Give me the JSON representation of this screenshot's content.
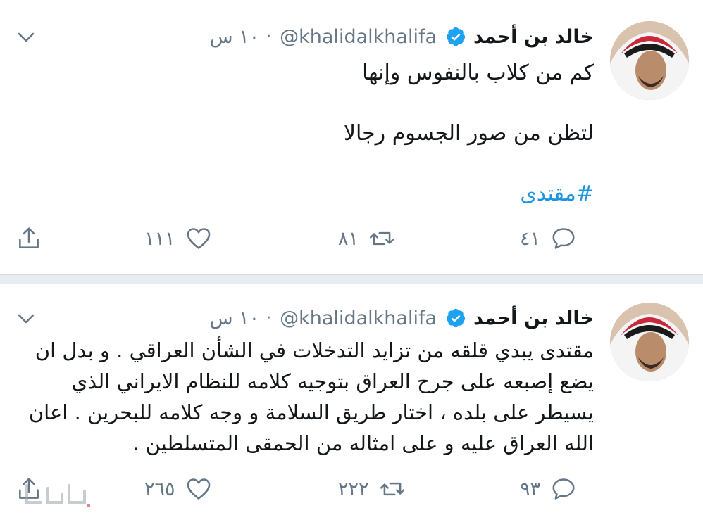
{
  "tweets": [
    {
      "author_name": "خالد بن أحمد",
      "handle": "@khalidalkhalifa",
      "separator": "·",
      "time": "١٠ س",
      "lines": [
        "كم من كلاب بالنفوس وإنها",
        "لتظن من صور الجسوم رجالا"
      ],
      "hashtag": "#مقتدى",
      "replies": "٤١",
      "retweets": "٨١",
      "likes": "١١١"
    },
    {
      "author_name": "خالد بن أحمد",
      "handle": "@khalidalkhalifa",
      "separator": "·",
      "time": "١٠ س",
      "body": "مقتدى يبدي قلقه من تزايد التدخلات في الشأن العراقي . و بدل ان يضع إصبعه على جرح العراق بتوجيه كلامه للنظام الايراني الذي يسيطر على بلده ، اختار  طريق السلامة و وجه كلامه للبحرين . اعان الله العراق عليه و على امثاله من الحمقى المتسلطين .",
      "replies": "٩٣",
      "retweets": "٢٢٢",
      "likes": "٢٦٥"
    }
  ],
  "icons": {
    "verified": "verified-badge-icon",
    "caret": "chevron-down-icon",
    "reply": "reply-icon",
    "retweet": "retweet-icon",
    "like": "heart-icon",
    "share": "share-icon"
  },
  "colors": {
    "text": "#14171a",
    "secondary": "#657786",
    "accent": "#1b95e0",
    "separator": "#e6ecf0"
  }
}
